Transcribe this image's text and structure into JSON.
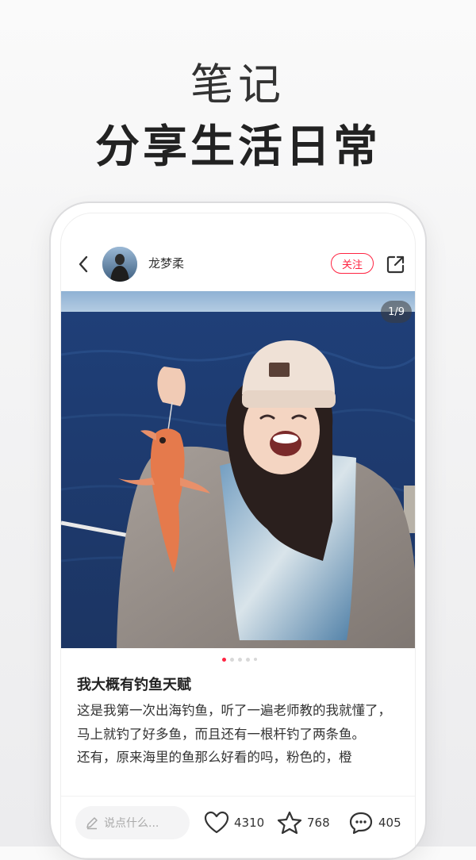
{
  "hero": {
    "line1": "笔记",
    "line2": "分享生活日常"
  },
  "header": {
    "author_name": "龙梦柔",
    "follow_label": "关注"
  },
  "photo": {
    "page_indicator": "1/9",
    "total_pages": 9,
    "current_page": 1
  },
  "note": {
    "title": "我大概有钓鱼天赋",
    "body": [
      "这是我第一次出海钓鱼，听了一遍老师教的我就懂了，马上就钓了好多鱼，而且还有一根杆钓了两条鱼。",
      "还有，原来海里的鱼那么好看的吗，粉色的，橙"
    ]
  },
  "bottom_bar": {
    "comment_placeholder": "说点什么...",
    "likes": "4310",
    "favorites": "768",
    "comments": "405"
  },
  "colors": {
    "accent": "#ff2442",
    "text": "#333333",
    "muted": "#aaaaaa"
  }
}
